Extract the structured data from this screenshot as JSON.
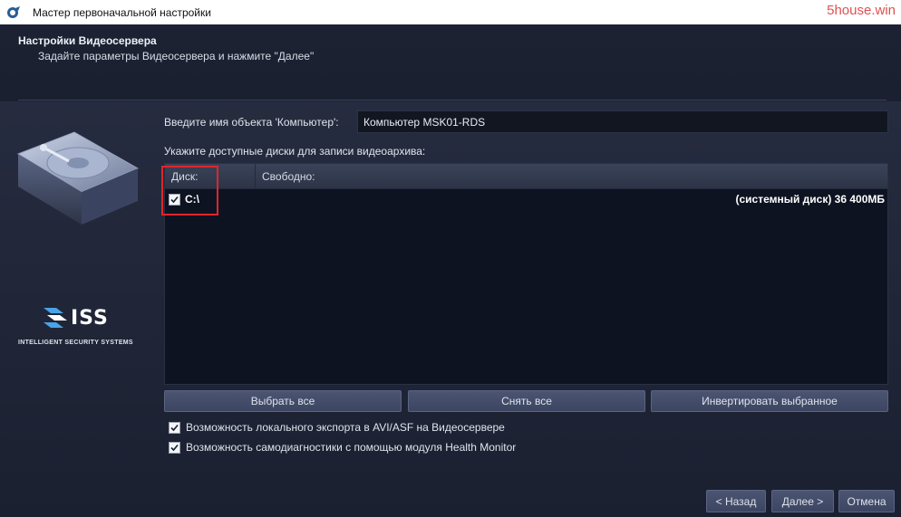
{
  "window": {
    "title": "Мастер первоначальной настройки",
    "watermark": "5house.win",
    "icon": "app-wizard-icon"
  },
  "header": {
    "title": "Настройки Видеосервера",
    "subtitle": "Задайте параметры Видеосервера и нажмите \"Далее\""
  },
  "branding": {
    "logo_text": "ISS",
    "caption": "INTELLIGENT SECURITY SYSTEMS",
    "illustration": "hard-disk-icon"
  },
  "form": {
    "name_label": "Введите имя объекта 'Компьютер':",
    "name_value": "Компьютер MSK01-RDS",
    "disks_label": "Укажите доступные диски для записи видеоархива:"
  },
  "disk_table": {
    "columns": [
      "Диск:",
      "Свободно:"
    ],
    "rows": [
      {
        "drive": "C:\\",
        "free": "(системный диск) 36 400МБ",
        "checked": true
      }
    ]
  },
  "buttons": {
    "select_all": "Выбрать все",
    "clear_all": "Снять все",
    "invert": "Инвертировать выбранное"
  },
  "options": [
    {
      "label": "Возможность локального экспорта в AVI/ASF на Видеосервере",
      "checked": true
    },
    {
      "label": "Возможность самодиагностики с помощью модуля Health Monitor",
      "checked": true
    }
  ],
  "footer": {
    "back": "< Назад",
    "next": "Далее >",
    "cancel": "Отмена"
  },
  "colors": {
    "background": "#1e2333",
    "highlight": "#e0252b",
    "watermark": "#e05050"
  }
}
